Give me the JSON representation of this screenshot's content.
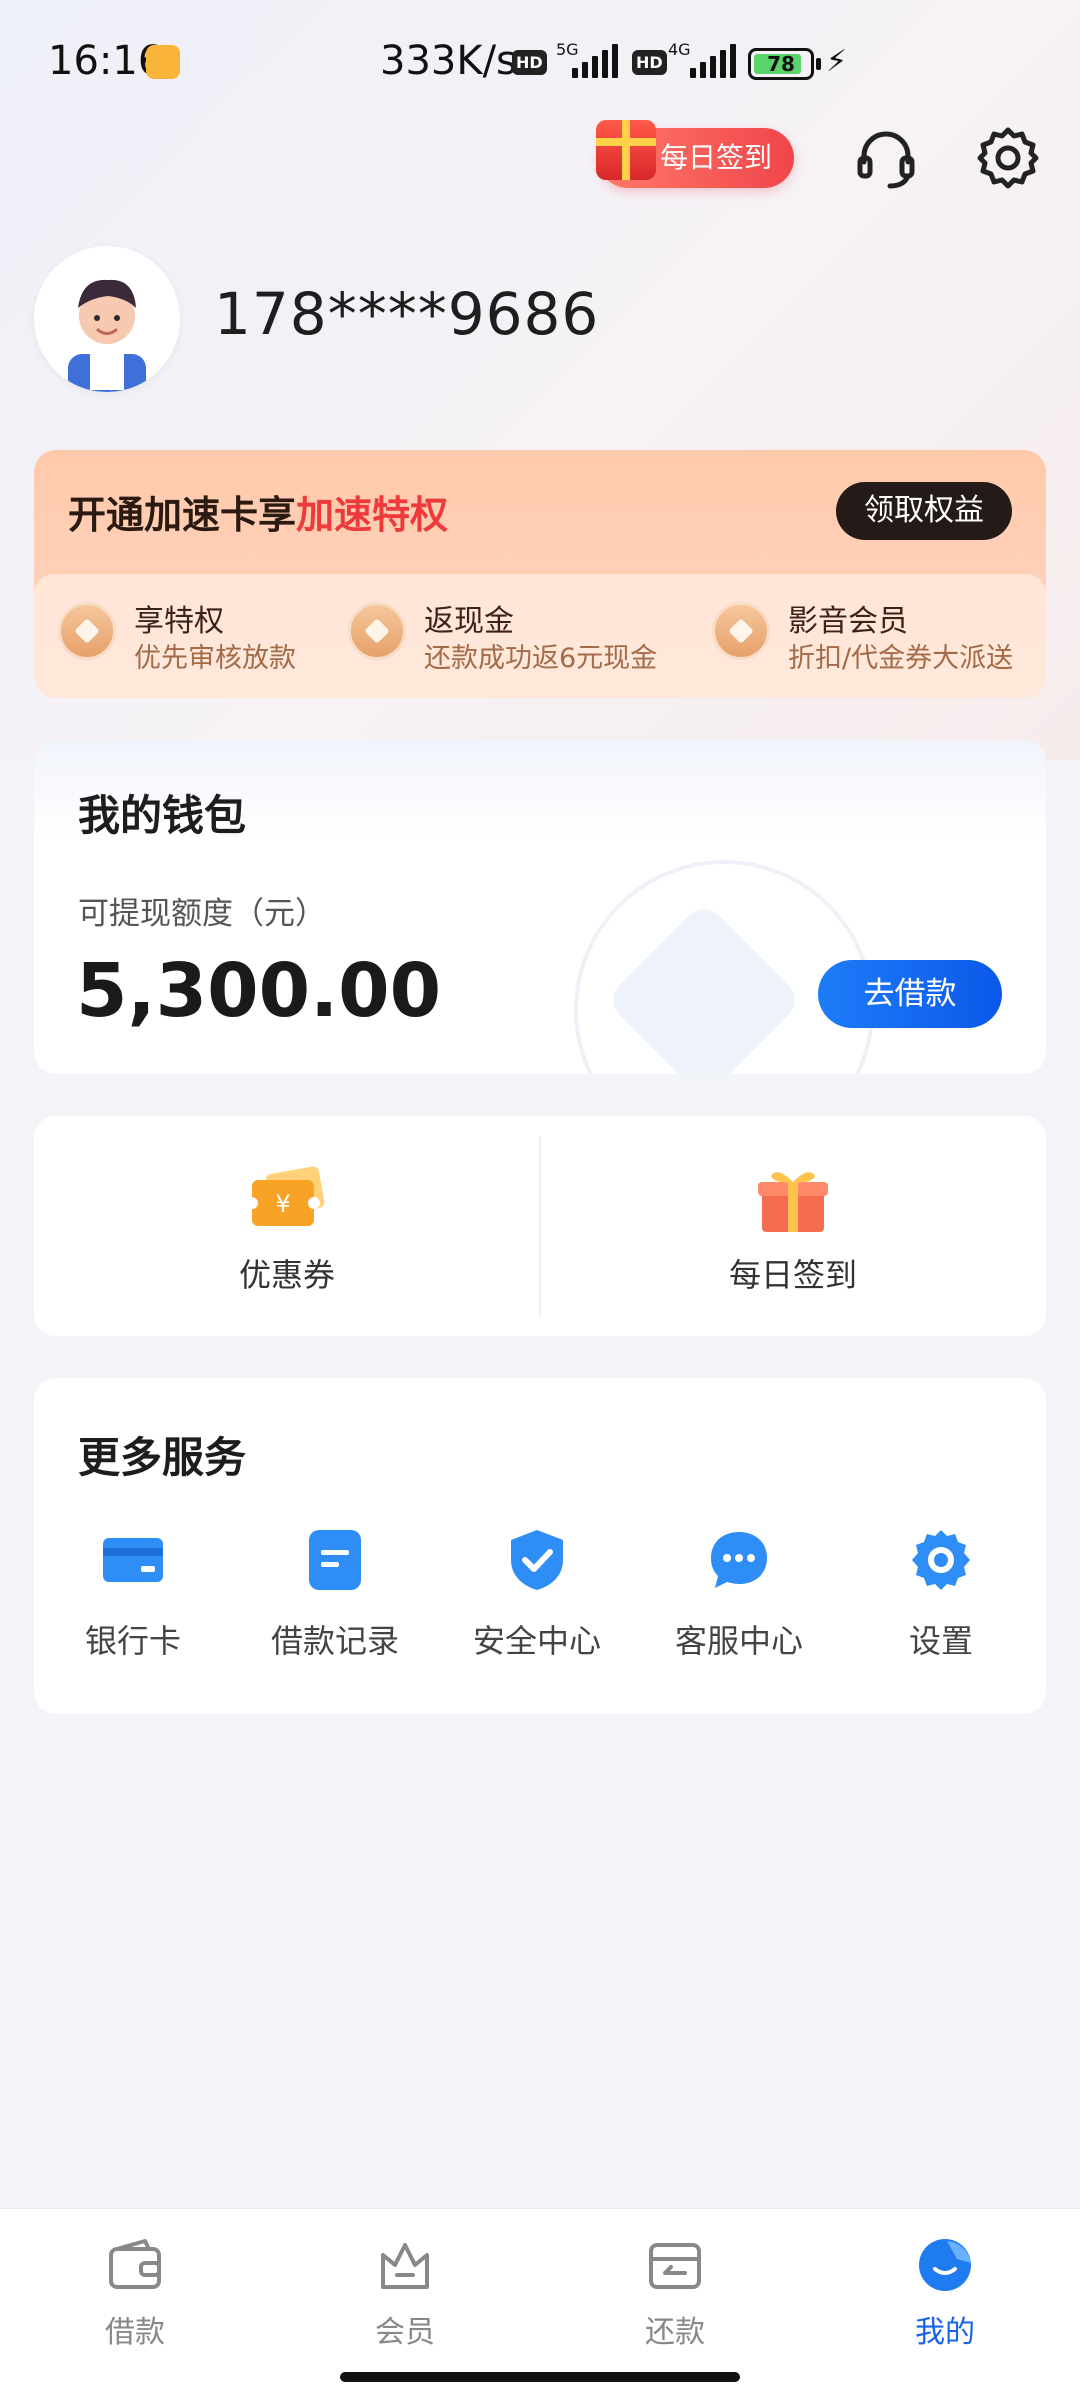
{
  "status_bar": {
    "time": "16:16",
    "net_speed": "333K/s",
    "hd1": "HD",
    "sig1": "5G",
    "hd2": "HD",
    "sig2": "4G",
    "battery": "78"
  },
  "header": {
    "checkin_label": "每日签到",
    "phone": "178****9686"
  },
  "speed_card": {
    "title_prefix": "开通加速卡享",
    "title_highlight": "加速特权",
    "claim_label": "领取权益",
    "perks": [
      {
        "title": "享特权",
        "desc": "优先审核放款"
      },
      {
        "title": "返现金",
        "desc": "还款成功返6元现金"
      },
      {
        "title": "影音会员",
        "desc": "折扣/代金券大派送"
      }
    ]
  },
  "wallet": {
    "title": "我的钱包",
    "sub": "可提现额度（元）",
    "amount": "5,300.00",
    "borrow_label": "去借款"
  },
  "quick": {
    "items": [
      {
        "label": "优惠券"
      },
      {
        "label": "每日签到"
      }
    ]
  },
  "services": {
    "title": "更多服务",
    "items": [
      {
        "label": "银行卡"
      },
      {
        "label": "借款记录"
      },
      {
        "label": "安全中心"
      },
      {
        "label": "客服中心"
      },
      {
        "label": "设置"
      }
    ]
  },
  "nav": {
    "items": [
      {
        "label": "借款"
      },
      {
        "label": "会员"
      },
      {
        "label": "还款"
      },
      {
        "label": "我的"
      }
    ],
    "active_color": "#1764e8"
  },
  "colors": {
    "accent_blue": "#0b58ea",
    "highlight_red": "#ee3a3a"
  }
}
